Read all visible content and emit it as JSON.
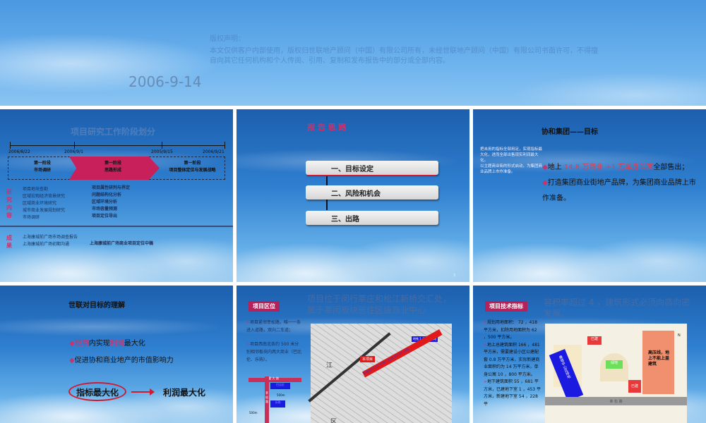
{
  "cover": {
    "copyright_title": "版权声明：",
    "copyright_text": "本文仅供客户内部使用，版权归世联地产顾问（中国）有限公司所有，未经世联地产顾问（中国）有限公司书面许可，不得擅自向其它任何机构和个人传阅、引用、复制和发布报告中的部分或全部内容。",
    "date": "2006-9-14"
  },
  "slide1": {
    "title": "项目研究工作阶段划分",
    "dates": [
      "2006/8/22",
      "2006/9/1",
      "2005/9/15",
      "2006/9/21"
    ],
    "phases": [
      {
        "stage": "第一阶段",
        "name": "市场调研"
      },
      {
        "stage": "第一阶段",
        "name": "思路形成"
      },
      {
        "stage": "第一阶段",
        "name": "项目整体定位与发展战略"
      }
    ],
    "research_label": "研究内容",
    "research_left": [
      "项目地块查勘",
      "区域宏观经济背景研究",
      "区域商业环境研究",
      "城市商业发展规划研究",
      "市场调研"
    ],
    "research_right": [
      "项目属性研判与界定",
      "问题结构化分析",
      "区域环境分析",
      "市场容量预测",
      "项目定位导出"
    ],
    "results_label": "成果",
    "results_left": [
      "上海康城前广场市场调查报告",
      "上海康城前广场初期沟通"
    ],
    "results_right": [
      "上海康城前广场商业项目定位中稿"
    ]
  },
  "slide2": {
    "title": "报 告 思 路",
    "items": [
      "一、目标设定",
      "二、风险和机会",
      "三、出路"
    ],
    "page": "3"
  },
  "slide3": {
    "title": "协和集团——目标",
    "side_notes": [
      "把未用的指标全部用足，实现指标最大化，进而全部出售现实利润最大化。",
      "以主题商业街的形式启动，为集团商业品牌上市作准备。"
    ],
    "b1_pre": "地上 ",
    "b1_hl": "14.8 万商业 +1 万单身公寓",
    "b1_post": "全部售出；",
    "b2": "打造集团商业街地产品牌，为集团商业品牌上市作准备。"
  },
  "slide4": {
    "title": "世联对目标的理解",
    "b1_hl1": "短期",
    "b1_mid": "内实现",
    "b1_hl2": "利润",
    "b1_post": "最大化",
    "b2": "促进协和商业地产的市值影响力",
    "crossed": "指标最大化",
    "result": "利润最大化"
  },
  "slide5": {
    "tag": "项目区位",
    "title": "项目位于闵行莘庄和松江新桥交汇处，属于莘闵板块居住区级商业中心",
    "bullets": [
      "项目紧邻莘松路，唯一一条进入道路，双向二车道；",
      "项目西南北各约 500 米分别相邻板块内两大商业（巴比伦、乐购）。"
    ],
    "map": {
      "metro": "地铁 1 号线莘庄站",
      "project": "本项目",
      "route": "车程步行 15 分钟，红线 20-40 分钟",
      "labels": [
        "江",
        "区"
      ]
    },
    "diagram": {
      "road_top": "北 翟 大 路",
      "road_side": "莘 松 路",
      "dist1": "500m",
      "dist2": "500m",
      "shop1": "巴比伦",
      "shop2": "乐购"
    }
  },
  "slide6": {
    "tag": "项目技术指标",
    "title": "容积率超过 4 ，建筑形式必须向高向密发展。",
    "text": [
      "规划用地面积： 72 ，418 平方米，扣除用地面积为 62 ，500 平方米。",
      "地上总建筑面积 166 ，481 平方米，需要建设小区公建配套 0.8 万平方米，实际新建商业面积约为 14 万平方米，单身公寓 10 ，800 平方米。",
      "地下建筑面积 55 ，681 平方米，已建地下室 1 ，453 平方米，新建地下室 54 ，228 平"
    ],
    "plan": {
      "built1": "已建",
      "built2": "已建",
      "green": "绿地",
      "hv": "高压线，地上不能上盖建筑",
      "strip": "康城中心区绿地",
      "road": "莘 松 路",
      "north": "N"
    }
  }
}
